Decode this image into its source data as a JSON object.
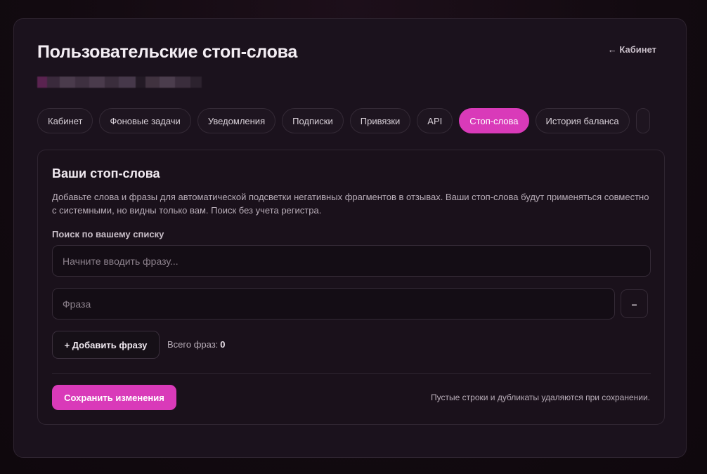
{
  "header": {
    "title": "Пользовательские стоп-слова",
    "back_link": "← Кабинет"
  },
  "tabs": [
    {
      "label": "Кабинет",
      "active": false
    },
    {
      "label": "Фоновые задачи",
      "active": false
    },
    {
      "label": "Уведомления",
      "active": false
    },
    {
      "label": "Подписки",
      "active": false
    },
    {
      "label": "Привязки",
      "active": false
    },
    {
      "label": "API",
      "active": false
    },
    {
      "label": "Стоп-слова",
      "active": true
    },
    {
      "label": "История баланса",
      "active": false
    }
  ],
  "card": {
    "title": "Ваши стоп-слова",
    "description": "Добавьте слова и фразы для автоматической подсветки негативных фрагментов в отзывах. Ваши стоп-слова будут применяться совместно с системными, но видны только вам. Поиск без учета регистра.",
    "search_label": "Поиск по вашему списку",
    "search_placeholder": "Начните вводить фразу...",
    "phrase_placeholder": "Фраза",
    "remove_label": "–",
    "add_label": "+ Добавить фразу",
    "total_label": "Всего фраз:",
    "total_value": "0",
    "save_label": "Сохранить изменения",
    "footer_note": "Пустые строки и дубликаты удаляются при сохранении."
  },
  "colors": {
    "accent": "#d93ab9",
    "background": "#120a10",
    "panel": "#1b121d"
  }
}
